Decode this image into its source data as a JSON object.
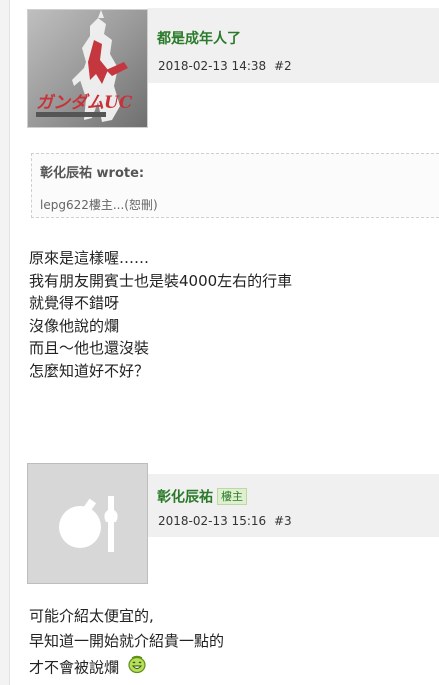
{
  "post2": {
    "author": "都是成年人了",
    "datetime": "2018-02-13 14:38",
    "number": "#2",
    "avatar_icon": "gundam-avatar-icon",
    "quote": {
      "author": "彰化辰祐 wrote:",
      "text": "lepg622樓主...(恕刪)"
    },
    "body_lines": [
      "原來是這樣喔……",
      "我有朋友開賓士也是裝4000左右的行車",
      "就覺得不錯呀",
      "沒像他說的爛",
      "而且～他也還沒裝",
      "怎麼知道好不好？"
    ]
  },
  "post3": {
    "author": "彰化辰祐",
    "badge": "樓主",
    "datetime": "2018-02-13 15:16",
    "number": "#3",
    "avatar_icon": "default-avatar-icon",
    "body_lines": [
      "可能介紹太便宜的,",
      "早知道一開始就介紹貴一點的",
      "才不會被說爛"
    ],
    "emoji_icon": "smiley-emoji-icon"
  },
  "colors": {
    "author": "#2b7a2b",
    "header_band": "#f0f0f0",
    "badge_bg": "#dff0d0"
  }
}
